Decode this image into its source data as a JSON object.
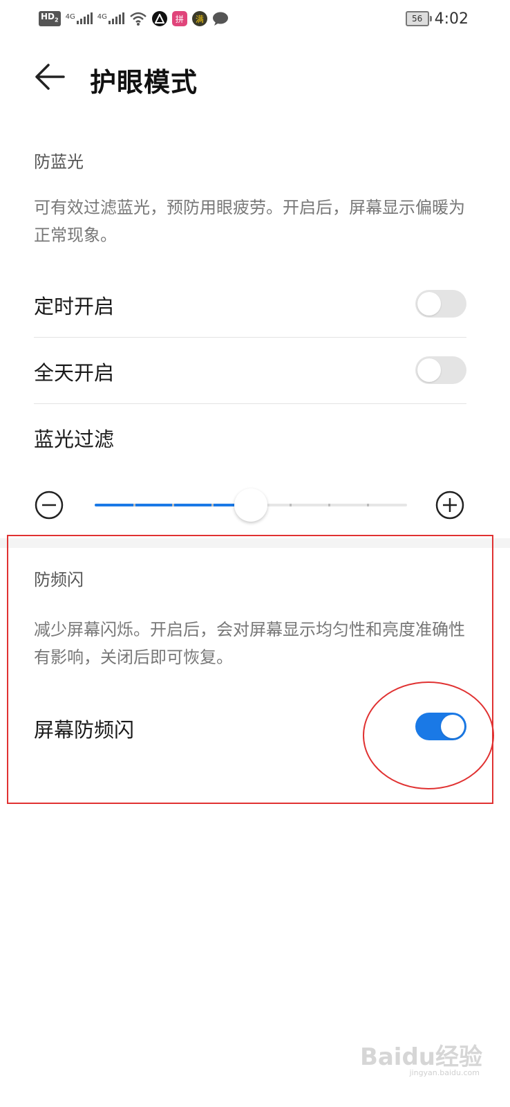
{
  "status_bar": {
    "hd_label": "HD",
    "hd_sub": "2",
    "network1": "4G",
    "network2": "4G",
    "app_icon_3_label": "拼",
    "app_icon_4_label": "满",
    "battery_level": "56",
    "time": "4:02"
  },
  "header": {
    "title": "护眼模式"
  },
  "blue_light": {
    "section_title": "防蓝光",
    "description": "可有效过滤蓝光，预防用眼疲劳。开启后，屏幕显示偏暖为正常现象。",
    "scheduled_label": "定时开启",
    "scheduled_on": false,
    "all_day_label": "全天开启",
    "all_day_on": false,
    "filter_label": "蓝光过滤",
    "filter_level_fraction": 0.5
  },
  "flicker": {
    "section_title": "防频闪",
    "description": "减少屏幕闪烁。开启后，会对屏幕显示均匀性和亮度准确性有影响，关闭后即可恢复。",
    "toggle_label": "屏幕防频闪",
    "toggle_on": true
  },
  "watermark": {
    "text": "Baidu经验",
    "sub": "jingyan.baidu.com"
  },
  "colors": {
    "accent": "#1a79e6",
    "annotation": "#e03131"
  }
}
